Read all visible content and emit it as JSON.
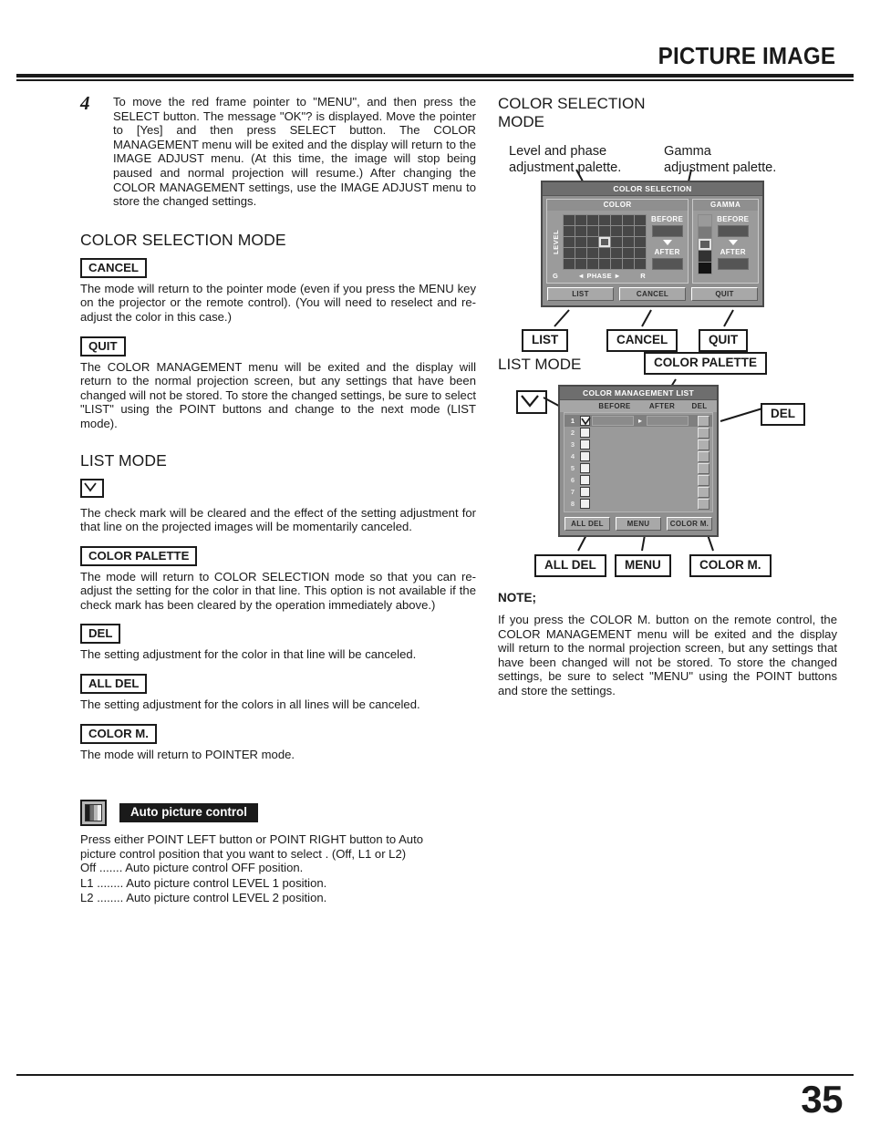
{
  "header": {
    "title": "PICTURE IMAGE"
  },
  "footer": {
    "page_number": "35"
  },
  "left_column": {
    "step": {
      "number": "4",
      "text": "To move the red frame pointer to \"MENU\", and then press the SELECT button. The message \"OK\"? is displayed. Move the pointer to [Yes] and then press SELECT button. The COLOR MANAGEMENT menu will be exited and the display will return to the IMAGE ADJUST menu. (At this time, the image will stop being paused and normal projection will resume.) After changing the COLOR MANAGEMENT settings, use the IMAGE ADJUST menu to store the changed settings."
    },
    "color_selection_mode": {
      "heading": "COLOR SELECTION MODE",
      "entries": [
        {
          "label": "CANCEL",
          "text": "The mode will return to the pointer mode (even if you press the MENU key on the projector or the remote control). (You will need to reselect and re-adjust the color in this case.)"
        },
        {
          "label": "QUIT",
          "text": "The COLOR MANAGEMENT menu will be exited and the display will return to the normal projection screen, but any settings that have been changed will not be stored. To store the changed settings, be sure to select \"LIST\" using the POINT buttons and change to the next mode (LIST mode)."
        }
      ]
    },
    "list_mode": {
      "heading": "LIST MODE",
      "entries": [
        {
          "label": "check-mark-icon",
          "text": "The check mark will be cleared and the effect of the setting adjustment for that line on the projected images will be momentarily canceled."
        },
        {
          "label": "COLOR PALETTE",
          "text": "The mode will return to COLOR SELECTION mode so that you can re-adjust the setting for the color in that line. This option is not available if the check mark has been cleared by the operation immediately above.)"
        },
        {
          "label": "DEL",
          "text": "The setting adjustment for the color in that line will be canceled."
        },
        {
          "label": "ALL DEL",
          "text": "The setting adjustment for the colors in all lines will be canceled."
        },
        {
          "label": "COLOR M.",
          "text": "The mode will return to POINTER mode."
        }
      ]
    },
    "auto_picture_control": {
      "icon": "gradient-bar-icon",
      "title": "Auto picture control",
      "intro_line1": "Press either POINT LEFT button or POINT RIGHT button to Auto",
      "intro_line2": "picture control position that you want to select . (Off, L1 or L2)",
      "options": [
        {
          "key": "Off .......",
          "desc": "Auto picture control OFF position."
        },
        {
          "key": "L1 ........",
          "desc": "Auto picture control LEVEL 1 position."
        },
        {
          "key": "L2 ........",
          "desc": "Auto picture control LEVEL 2 position."
        }
      ]
    }
  },
  "right_column": {
    "color_selection_mode": {
      "heading_line1": "COLOR SELECTION",
      "heading_line2": "MODE",
      "callout_level_line1": "Level and phase",
      "callout_level_line2": "adjustment palette.",
      "callout_gamma_line1": "Gamma",
      "callout_gamma_line2": "adjustment palette.",
      "osd": {
        "title": "COLOR SELECTION",
        "color_header": "COLOR",
        "gamma_header": "GAMMA",
        "level_label": "LEVEL",
        "phase_left": "G",
        "phase_label": "PHASE",
        "phase_right": "R",
        "before_label": "BEFORE",
        "after_label": "AFTER",
        "grid_cols": 7,
        "grid_rows": 5,
        "grid_selected": {
          "row": 3,
          "col": 4
        },
        "gamma_cells": [
          "#9a9a9a",
          "#7a7a7a",
          "#5c5c5c",
          "#323232",
          "#141414"
        ],
        "gamma_selected_index": 3,
        "buttons": [
          "LIST",
          "CANCEL",
          "QUIT"
        ]
      },
      "callout_boxes": [
        "LIST",
        "CANCEL",
        "QUIT"
      ]
    },
    "list_mode": {
      "heading": "LIST MODE",
      "callout_color_palette": "COLOR PALETTE",
      "callout_del": "DEL",
      "callout_check": "check-mark-icon",
      "osd": {
        "title": "COLOR MANAGEMENT LIST",
        "col_before": "BEFORE",
        "col_after": "AFTER",
        "col_del": "DEL",
        "rows": [
          "1",
          "2",
          "3",
          "4",
          "5",
          "6",
          "7",
          "8"
        ],
        "active_row": "1",
        "buttons": [
          "ALL DEL",
          "MENU",
          "COLOR M."
        ]
      },
      "callout_boxes": [
        "ALL DEL",
        "MENU",
        "COLOR M."
      ]
    },
    "note": {
      "title": "NOTE;",
      "text": "If you press the COLOR M. button on the remote control, the COLOR MANAGEMENT menu will be exited and the display will return to the normal projection screen, but any settings that have been changed will not be stored. To store the changed settings, be sure to select \"MENU\" using the POINT buttons and store the settings."
    }
  }
}
